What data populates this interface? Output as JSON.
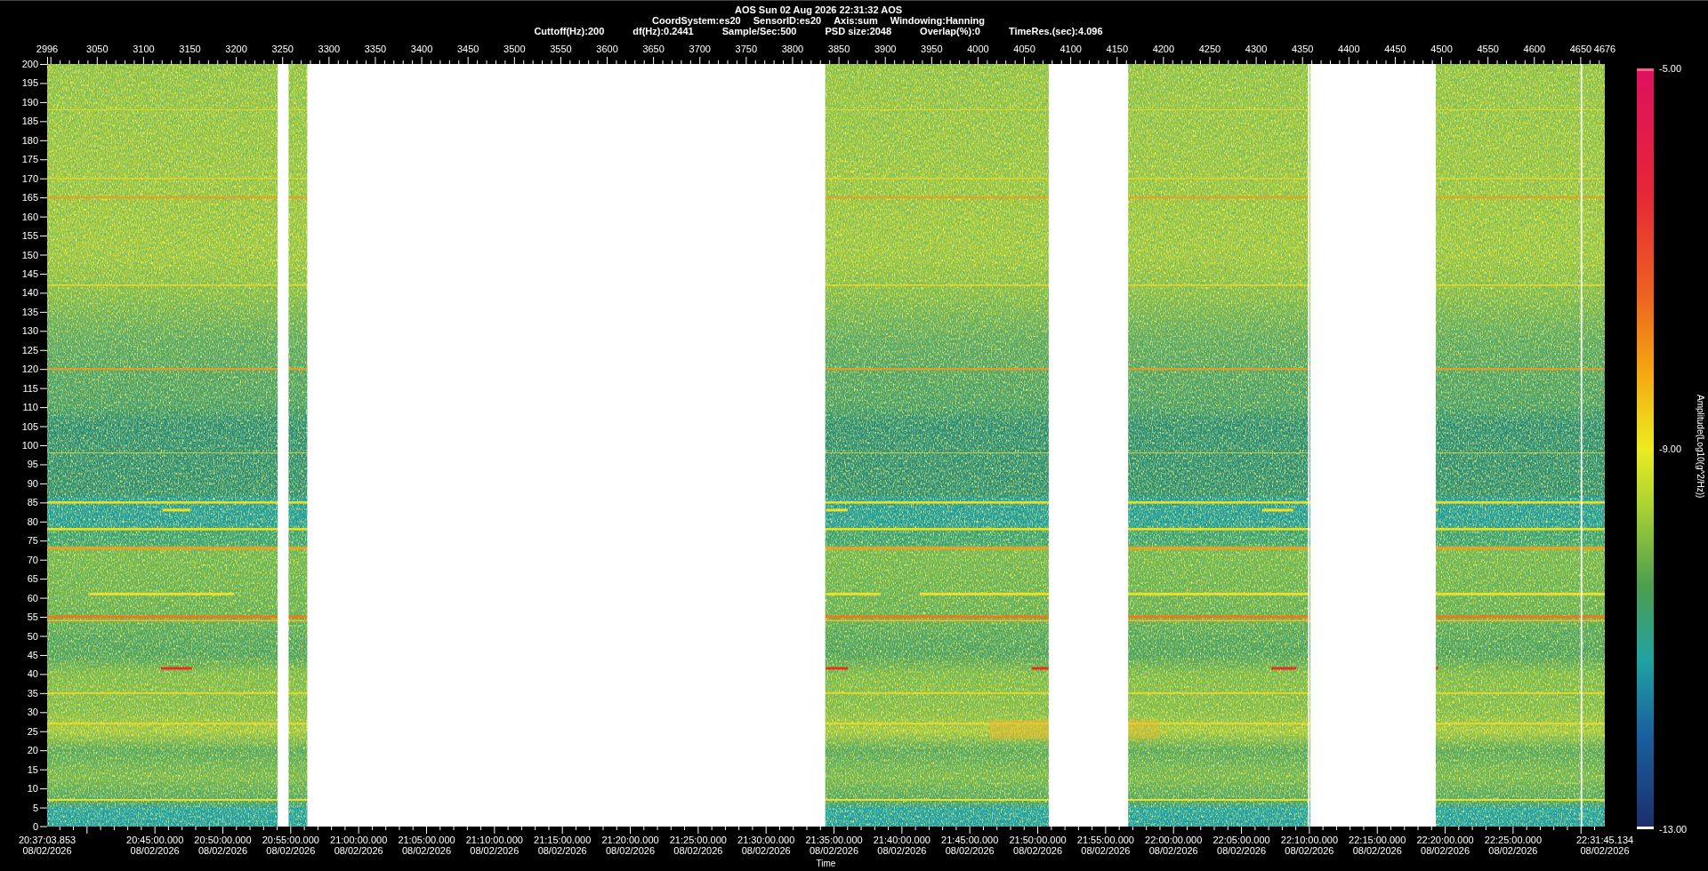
{
  "header": {
    "title": "AOS  Sun 02 Aug 2026 22:31:32  AOS",
    "line_2": [
      "CoordSystem:es20",
      "SensorID:es20",
      "Axis:sum",
      "Windowing:Hanning"
    ],
    "line_3": [
      "Cuttoff(Hz):200",
      "df(Hz):0.2441",
      "Sample/Sec:500",
      "PSD size:2048",
      "Overlap(%):0",
      "TimeRes.(sec):4.096"
    ]
  },
  "top_axis": {
    "labels": [
      "2996",
      "3050",
      "3100",
      "3150",
      "3200",
      "3250",
      "3300",
      "3350",
      "3400",
      "3450",
      "3500",
      "3550",
      "3600",
      "3650",
      "3700",
      "3750",
      "3800",
      "3850",
      "3900",
      "3950",
      "4000",
      "4050",
      "4100",
      "4150",
      "4200",
      "4250",
      "4300",
      "4350",
      "4400",
      "4450",
      "4500",
      "4550",
      "4600",
      "4650",
      "4676"
    ]
  },
  "frequency_axis": {
    "labels": [
      "200",
      "195",
      "190",
      "185",
      "180",
      "175",
      "170",
      "165",
      "160",
      "155",
      "150",
      "145",
      "140",
      "135",
      "130",
      "125",
      "120",
      "115",
      "110",
      "105",
      "100",
      "95",
      "90",
      "85",
      "80",
      "75",
      "70",
      "65",
      "60",
      "55",
      "50",
      "45",
      "40",
      "35",
      "30",
      "25",
      "20",
      "15",
      "10",
      "5",
      "0"
    ]
  },
  "time_axis": {
    "title": "Time",
    "labels": [
      {
        "time": "20:37:03.853",
        "date": "08/02/2026"
      },
      {
        "time": "20:45:00.000",
        "date": "08/02/2026"
      },
      {
        "time": "20:50:00.000",
        "date": "08/02/2026"
      },
      {
        "time": "20:55:00.000",
        "date": "08/02/2026"
      },
      {
        "time": "21:00:00.000",
        "date": "08/02/2026"
      },
      {
        "time": "21:05:00.000",
        "date": "08/02/2026"
      },
      {
        "time": "21:10:00.000",
        "date": "08/02/2026"
      },
      {
        "time": "21:15:00.000",
        "date": "08/02/2026"
      },
      {
        "time": "21:20:00.000",
        "date": "08/02/2026"
      },
      {
        "time": "21:25:00.000",
        "date": "08/02/2026"
      },
      {
        "time": "21:30:00.000",
        "date": "08/02/2026"
      },
      {
        "time": "21:35:00.000",
        "date": "08/02/2026"
      },
      {
        "time": "21:40:00.000",
        "date": "08/02/2026"
      },
      {
        "time": "21:45:00.000",
        "date": "08/02/2026"
      },
      {
        "time": "21:50:00.000",
        "date": "08/02/2026"
      },
      {
        "time": "21:55:00.000",
        "date": "08/02/2026"
      },
      {
        "time": "22:00:00.000",
        "date": "08/02/2026"
      },
      {
        "time": "22:05:00.000",
        "date": "08/02/2026"
      },
      {
        "time": "22:10:00.000",
        "date": "08/02/2026"
      },
      {
        "time": "22:15:00.000",
        "date": "08/02/2026"
      },
      {
        "time": "22:20:00.000",
        "date": "08/02/2026"
      },
      {
        "time": "22:25:00.000",
        "date": "08/02/2026"
      },
      {
        "time": "22:31:45.134",
        "date": "08/02/2026"
      }
    ]
  },
  "color_scale": {
    "title": "Amplitude(Log10(g^2/Hz))",
    "labels": [
      "-5.00",
      "-9.00",
      "-13.00"
    ]
  }
}
